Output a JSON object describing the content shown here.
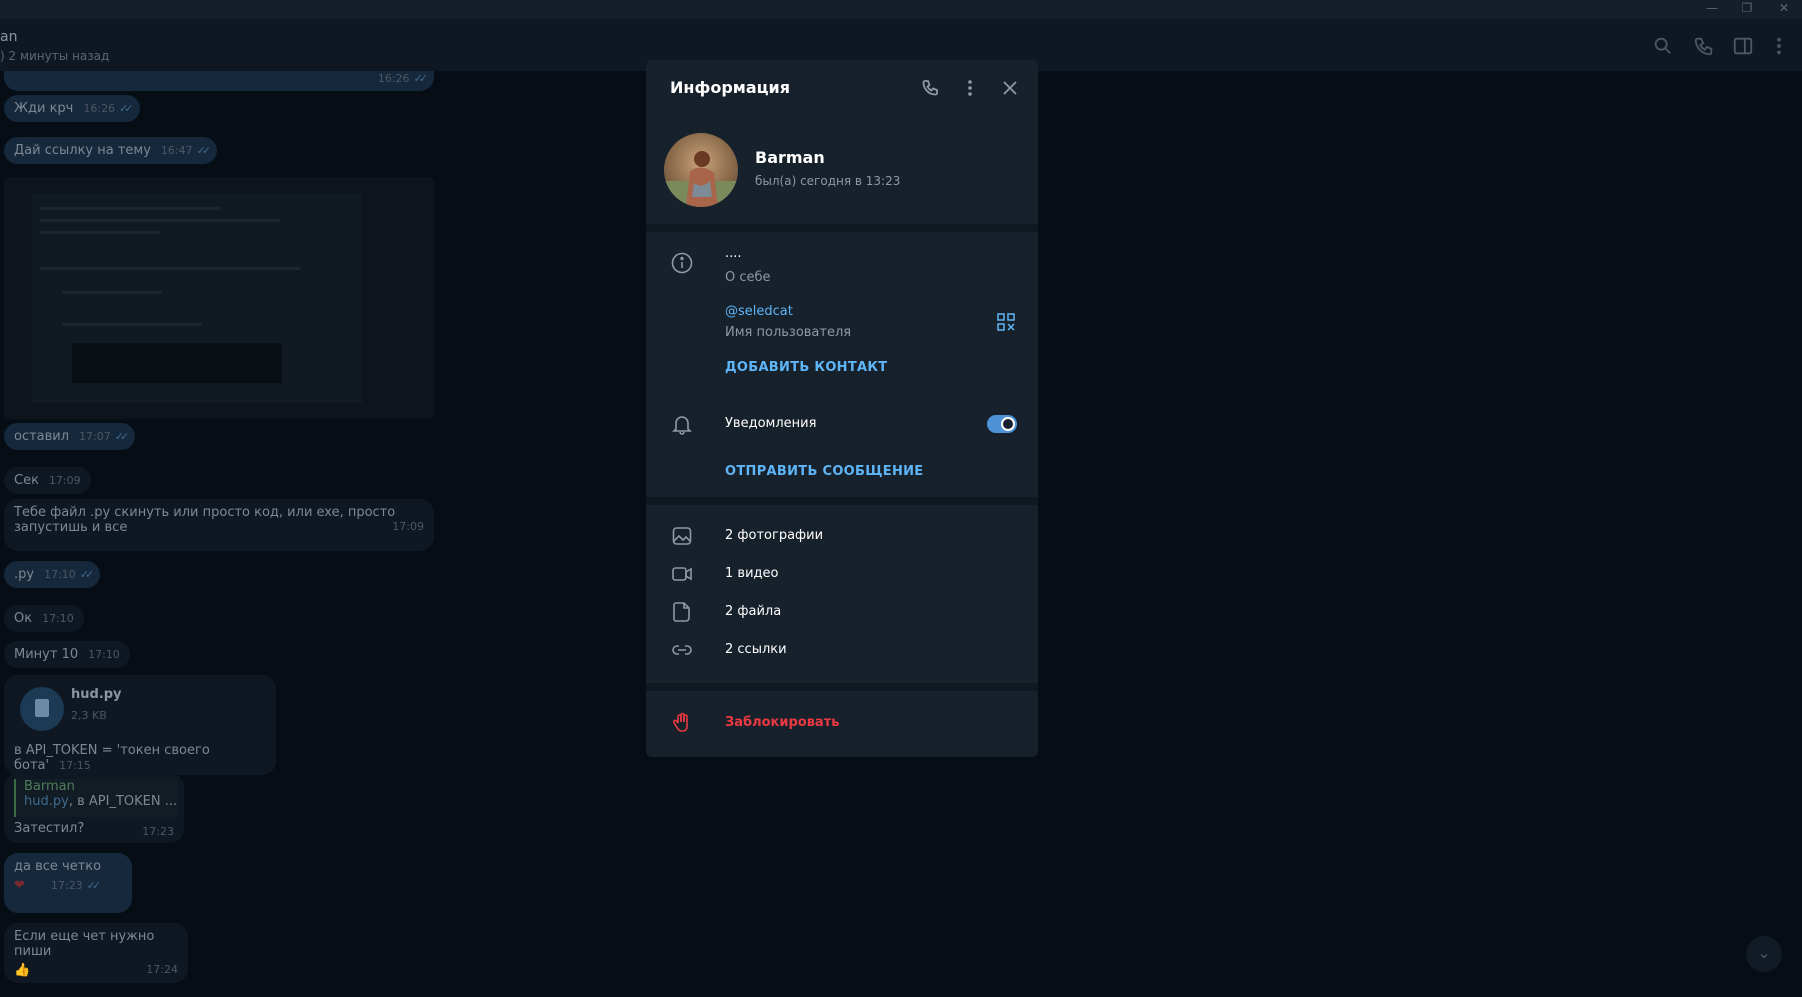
{
  "window": {
    "controls": [
      "minimize",
      "restore",
      "close"
    ]
  },
  "chat_header": {
    "name": "an",
    "status": ") 2 минуты назад",
    "icons": [
      "search-icon",
      "phone-icon",
      "sidebar-icon",
      "more-vert-icon"
    ]
  },
  "messages": [
    {
      "text": "",
      "time": "16:26",
      "dir": "out",
      "read": true
    },
    {
      "text": "Жди крч",
      "time": "16:26",
      "dir": "out",
      "read": true
    },
    {
      "text": "Дай ссылку на тему",
      "time": "16:47",
      "dir": "out",
      "read": true
    },
    {
      "text": "оставил",
      "time": "17:07",
      "dir": "out",
      "read": true
    },
    {
      "text": "Сек",
      "time": "17:09",
      "dir": "in"
    },
    {
      "text": "Тебе файл .py скинуть или просто код, или exe, просто",
      "text2": "запустишь и все",
      "time": "17:09",
      "dir": "in"
    },
    {
      "text": ".py",
      "time": "17:10",
      "dir": "out",
      "read": true
    },
    {
      "text": "Ок",
      "time": "17:10",
      "dir": "in"
    },
    {
      "text": "Минут 10",
      "time": "17:10",
      "dir": "in"
    },
    {
      "file_name": "hud.py",
      "file_size": "2,3 KB",
      "caption": "в API_TOKEN = 'токен своего бота'",
      "time": "17:15",
      "dir": "in"
    },
    {
      "reply_author": "Barman",
      "reply_file": "hud.py",
      "reply_text": ", в API_TOKEN ...",
      "text": "Затестил?",
      "time": "17:23",
      "dir": "in"
    },
    {
      "text": "да все четко",
      "time": "17:23",
      "dir": "out",
      "read": true,
      "reactions": "❤"
    },
    {
      "text": "Если еще чет нужно пиши",
      "time": "17:24",
      "dir": "in",
      "reactions": "👍"
    }
  ],
  "dialog": {
    "title": "Информация",
    "profile": {
      "name": "Barman",
      "status": "был(а) сегодня в 13:23"
    },
    "bio": {
      "value": "....",
      "label": "О себе"
    },
    "username": {
      "value": "@seledcat",
      "label": "Имя пользователя"
    },
    "add_contact": "ДОБАВИТЬ КОНТАКТ",
    "notifications": {
      "label": "Уведомления",
      "enabled": true
    },
    "send_message": "ОТПРАВИТЬ СООБЩЕНИЕ",
    "media": [
      {
        "label": "2 фотографии",
        "icon": "photo-icon"
      },
      {
        "label": "1 видео",
        "icon": "video-icon"
      },
      {
        "label": "2 файла",
        "icon": "file-icon"
      },
      {
        "label": "2 ссылки",
        "icon": "link-icon"
      }
    ],
    "block": "Заблокировать"
  },
  "colors": {
    "accent": "#5eb5f7",
    "danger": "#ec3942",
    "dialog_bg": "#17212b"
  }
}
